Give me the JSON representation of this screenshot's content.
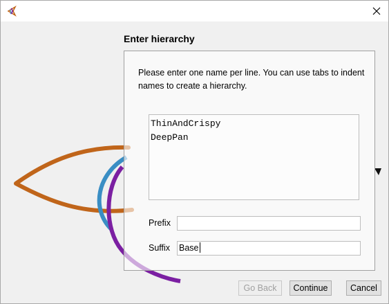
{
  "window": {
    "app_icon": "app-logo-icon",
    "close_icon": "close-icon"
  },
  "dialog": {
    "heading": "Enter hierarchy",
    "instructions": "Please enter one name per line. You can use tabs to indent names to create a hierarchy.",
    "names_text": "ThinAndCrispy\nDeepPan",
    "prefix_label": "Prefix",
    "prefix_value": "",
    "suffix_label": "Suffix",
    "suffix_value": "Base"
  },
  "buttons": {
    "back": "Go Back",
    "continue": "Continue",
    "cancel": "Cancel"
  },
  "colors": {
    "orange_stroke": "#c0651a",
    "blue_stroke": "#3a8ec4",
    "purple_stroke": "#7b1fa2"
  }
}
